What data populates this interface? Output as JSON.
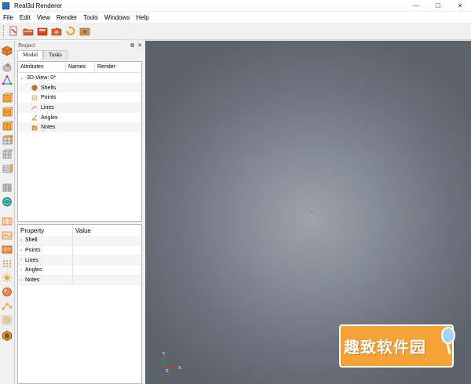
{
  "window": {
    "title": "Real3d Renderer",
    "controls": {
      "minimize": "—",
      "maximize": "☐",
      "close": "✕"
    }
  },
  "menu": [
    "File",
    "Edit",
    "View",
    "Render",
    "Tools",
    "Windows",
    "Help"
  ],
  "toolbar": {
    "buttons": [
      "new-scene-icon",
      "open-folder-icon",
      "save-icon",
      "camera-icon",
      "refresh-icon",
      "render-icon"
    ]
  },
  "left_toolbar": {
    "buttons": [
      "box-icon",
      "mesh-icon",
      "axes-icon",
      "cube-orange-icon",
      "cube-stack-icon",
      "cube-layer-icon",
      "cube-grid-icon",
      "cube-array-icon",
      "cube-slices-icon",
      "cube-wire-icon",
      "globe-icon",
      "frame-icon",
      "image-icon",
      "texture-icon",
      "dots-icon",
      "sun-icon",
      "sphere-icon",
      "nodes-icon",
      "gradient-sphere-icon",
      "hexagon-icon"
    ]
  },
  "project_panel": {
    "header": "Project",
    "header_controls": {
      "float": "⧉",
      "close": "✕"
    },
    "tabs": [
      "Model",
      "Tasks"
    ],
    "tree": {
      "columns": [
        "Attributes",
        "Names",
        "Render"
      ],
      "root": "3D-View: 0*",
      "items": [
        {
          "label": "Shells",
          "icon": "shell-icon"
        },
        {
          "label": "Points",
          "icon": "points-icon"
        },
        {
          "label": "Lines",
          "icon": "lines-icon"
        },
        {
          "label": "Angles",
          "icon": "angles-icon"
        },
        {
          "label": "Notes",
          "icon": "notes-icon"
        }
      ]
    },
    "properties": {
      "columns": [
        "Property",
        "Value"
      ],
      "rows": [
        "Shell",
        "Points",
        "Lines",
        "Angles",
        "Notes"
      ]
    }
  },
  "viewport": {
    "axis_labels": {
      "y": "Y",
      "x": "X",
      "z": "Z"
    }
  },
  "watermark": {
    "text": "趣致软件园"
  },
  "colors": {
    "accent_orange": "#f4a233",
    "viewport_center": "#9da3ab",
    "viewport_edge": "#5d636b"
  }
}
